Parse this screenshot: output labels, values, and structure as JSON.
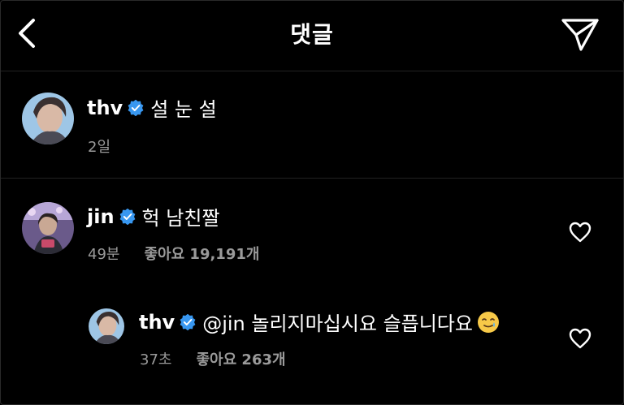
{
  "header": {
    "title": "댓글"
  },
  "comments": [
    {
      "username": "thv",
      "text": "설 눈 설",
      "time": "2일"
    },
    {
      "username": "jin",
      "text": "헉 남친짤",
      "time": "49분",
      "likes": "좋아요 19,191개"
    }
  ],
  "reply": {
    "username": "thv",
    "text": "@jin 놀리지마십시요 슬픕니다요",
    "emoji": "smiling-face-with-tear",
    "time": "37초",
    "likes": "좋아요 263개"
  },
  "colors": {
    "background": "#000000",
    "verified_badge": "#3897f0",
    "secondary_text": "#9a9a9a"
  }
}
